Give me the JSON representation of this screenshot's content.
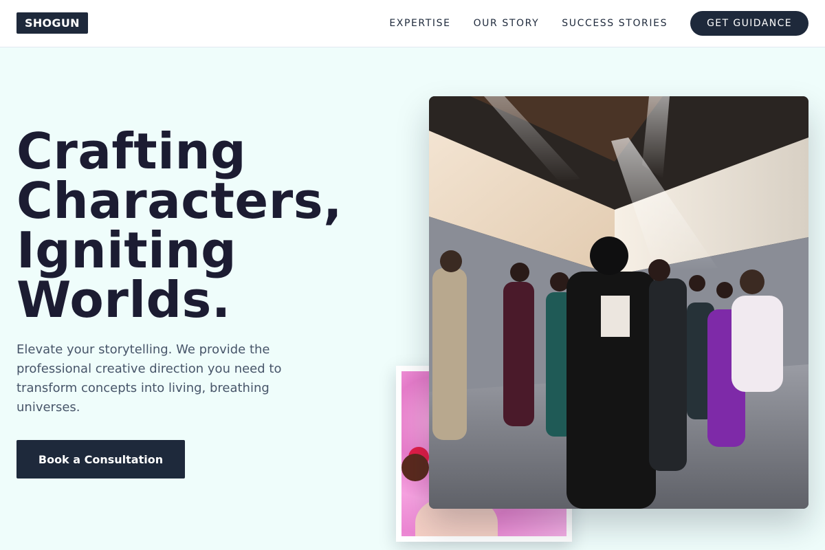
{
  "brand": {
    "logo": "SHOGUN"
  },
  "nav": {
    "links": [
      "EXPERTISE",
      "OUR STORY",
      "SUCCESS STORIES"
    ],
    "cta": "GET GUIDANCE"
  },
  "hero": {
    "title_lines": [
      "Crafting",
      "Characters,",
      "Igniting",
      "Worlds."
    ],
    "description": "Elevate your storytelling. We provide the professional creative direction you need to transform concepts into living, breathing universes.",
    "button": "Book a Consultation"
  },
  "images": {
    "main_photo": "fashion-show-stage-photo",
    "small_photo": "pink-candy-photo"
  },
  "colors": {
    "primary": "#1e293b",
    "background": "#effdfb",
    "title": "#1c1c32",
    "body_text": "#475569"
  }
}
